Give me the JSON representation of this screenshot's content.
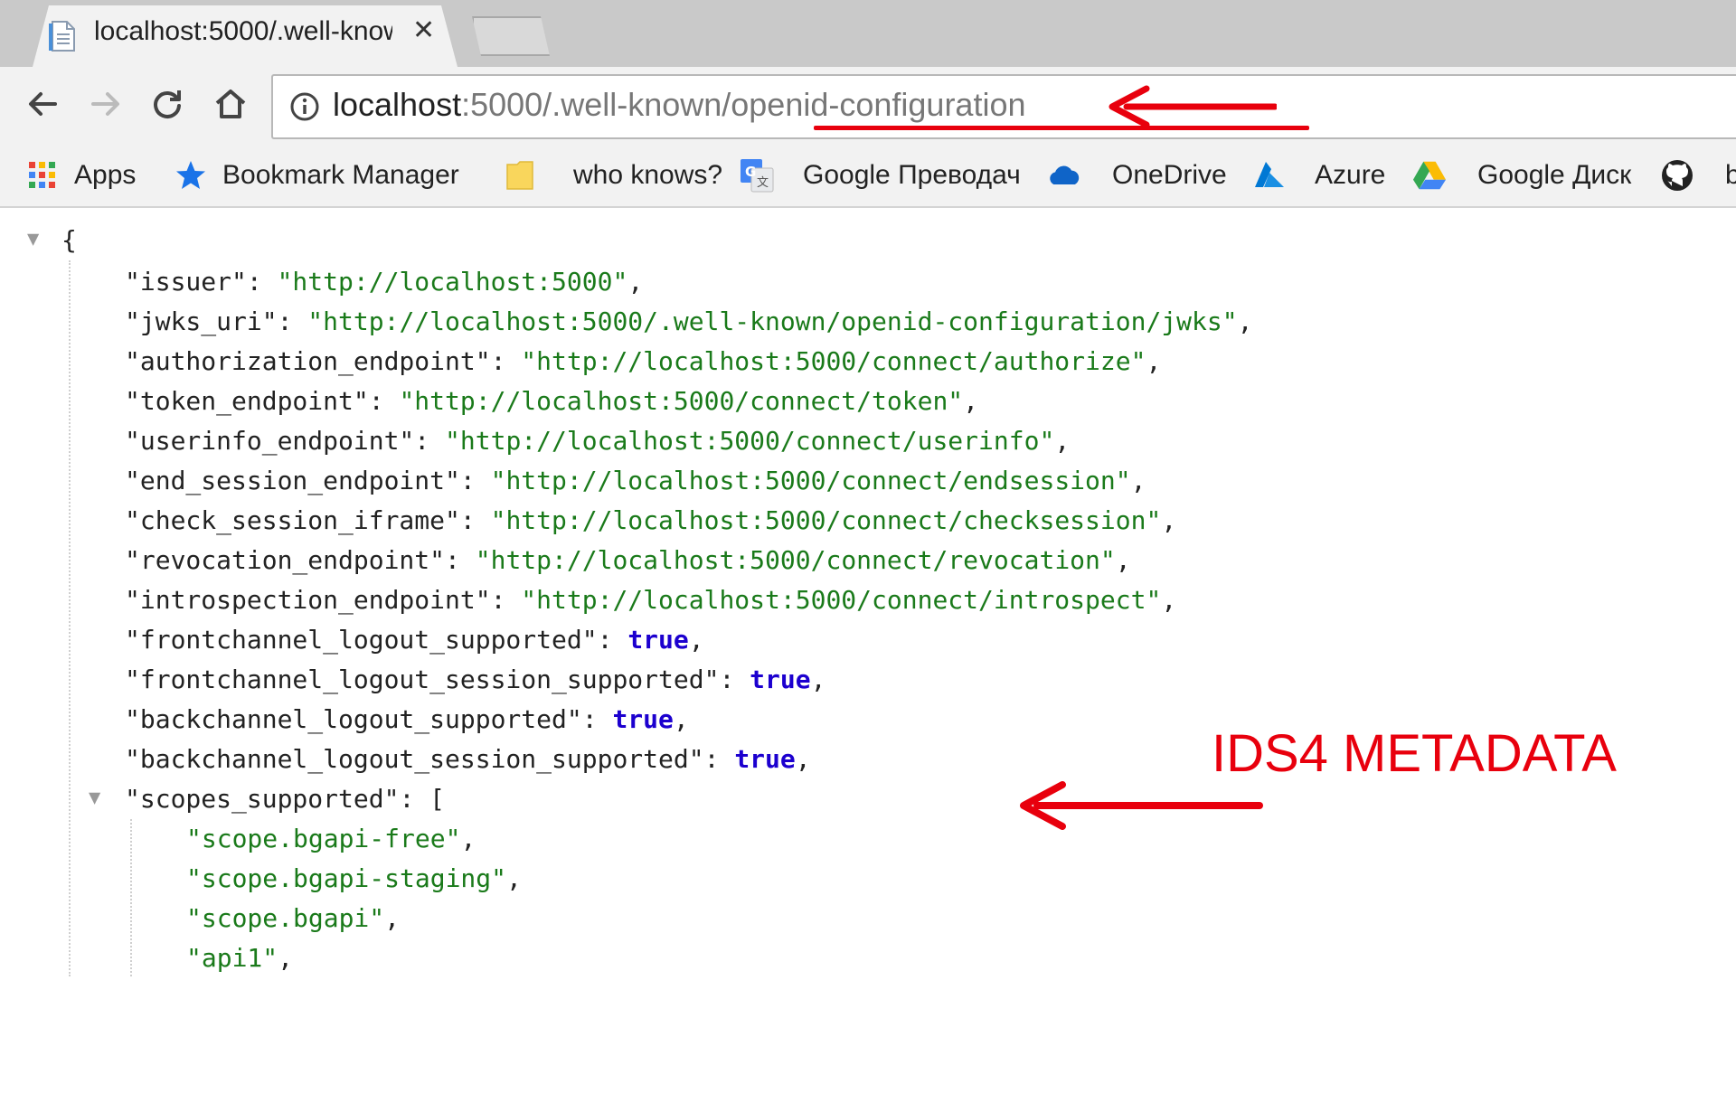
{
  "browser": {
    "tab_title": "localhost:5000/.well-know",
    "address": {
      "host": "localhost",
      "port": ":5000/",
      "path": ".well-known/openid-configuration"
    }
  },
  "bookmarks": [
    {
      "label": "Apps",
      "icon": "apps-grid-icon"
    },
    {
      "label": "Bookmark Manager",
      "icon": "star-icon"
    },
    {
      "label": "who knows?",
      "icon": "folder-icon"
    },
    {
      "label": "Google Преводач",
      "icon": "google-translate-icon"
    },
    {
      "label": "OneDrive",
      "icon": "onedrive-cloud-icon"
    },
    {
      "label": "Azure",
      "icon": "azure-icon"
    },
    {
      "label": "Google Диск",
      "icon": "google-drive-icon"
    },
    {
      "label": "b",
      "icon": "github-icon"
    }
  ],
  "json": {
    "open_brace": "{",
    "entries": [
      {
        "key": "\"issuer\"",
        "value": "\"http://localhost:5000\"",
        "type": "string"
      },
      {
        "key": "\"jwks_uri\"",
        "value": "\"http://localhost:5000/.well-known/openid-configuration/jwks\"",
        "type": "string"
      },
      {
        "key": "\"authorization_endpoint\"",
        "value": "\"http://localhost:5000/connect/authorize\"",
        "type": "string"
      },
      {
        "key": "\"token_endpoint\"",
        "value": "\"http://localhost:5000/connect/token\"",
        "type": "string"
      },
      {
        "key": "\"userinfo_endpoint\"",
        "value": "\"http://localhost:5000/connect/userinfo\"",
        "type": "string"
      },
      {
        "key": "\"end_session_endpoint\"",
        "value": "\"http://localhost:5000/connect/endsession\"",
        "type": "string"
      },
      {
        "key": "\"check_session_iframe\"",
        "value": "\"http://localhost:5000/connect/checksession\"",
        "type": "string"
      },
      {
        "key": "\"revocation_endpoint\"",
        "value": "\"http://localhost:5000/connect/revocation\"",
        "type": "string"
      },
      {
        "key": "\"introspection_endpoint\"",
        "value": "\"http://localhost:5000/connect/introspect\"",
        "type": "string"
      },
      {
        "key": "\"frontchannel_logout_supported\"",
        "value": "true",
        "type": "bool"
      },
      {
        "key": "\"frontchannel_logout_session_supported\"",
        "value": "true",
        "type": "bool"
      },
      {
        "key": "\"backchannel_logout_supported\"",
        "value": "true",
        "type": "bool"
      },
      {
        "key": "\"backchannel_logout_session_supported\"",
        "value": "true",
        "type": "bool"
      }
    ],
    "scopes_key": "\"scopes_supported\"",
    "scopes_open": "[",
    "scopes": [
      "\"scope.bgapi-free\"",
      "\"scope.bgapi-staging\"",
      "\"scope.bgapi\"",
      "\"api1\""
    ]
  },
  "annotation": {
    "text": "IDS4 METADATA",
    "color": "#e8000d"
  }
}
